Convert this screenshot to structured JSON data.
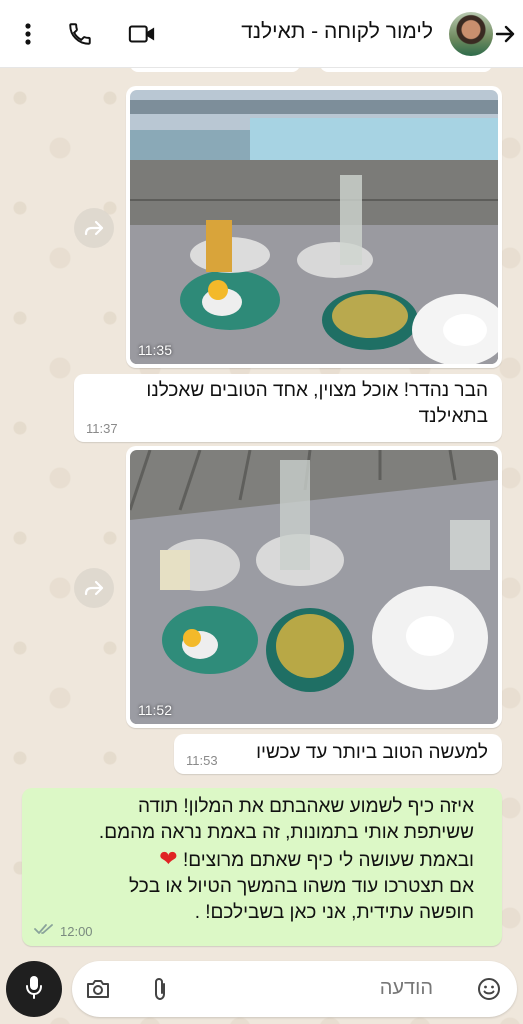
{
  "header": {
    "chat_name": "לימור לקוחה - תאילנד",
    "icons": [
      "kebab-menu-icon",
      "phone-icon",
      "video-icon",
      "avatar",
      "back-arrow-icon"
    ]
  },
  "messages": [
    {
      "type": "photo",
      "time": "11:35",
      "forwardable": true
    },
    {
      "type": "text",
      "direction": "in",
      "lines": [
        "הבר נהדר! אוכל מצוין, אחד הטובים שאכלנו",
        "בתאילנד"
      ],
      "time": "11:37"
    },
    {
      "type": "photo",
      "time": "11:52",
      "forwardable": true
    },
    {
      "type": "text",
      "direction": "in",
      "lines": [
        "למעשה הטוב ביותר עד עכשיו"
      ],
      "time": "11:53"
    },
    {
      "type": "text",
      "direction": "out",
      "lines": [
        "איזה כיף לשמוע שאהבתם את המלון! תודה",
        "ששיתפת אותי בתמונות, זה באמת נראה מהמם.",
        "ובאמת שעושה לי כיף שאתם מרוצים!",
        "אם תצטרכו עוד משהו בהמשך הטיול או בכל",
        "חופשה עתידית, אני כאן בשבילכם! ."
      ],
      "heart": "❤",
      "time": "12:00",
      "status": "read-ticks-icon"
    }
  ],
  "input": {
    "placeholder": "הודעה",
    "icons": [
      "emoji-icon",
      "attach-icon",
      "camera-icon",
      "mic-icon"
    ]
  },
  "colors": {
    "header_bg": "#ffffff",
    "outgoing_bubble": "#dcf8c6",
    "incoming_bubble": "#ffffff",
    "wallpaper": "#efe7dc"
  }
}
